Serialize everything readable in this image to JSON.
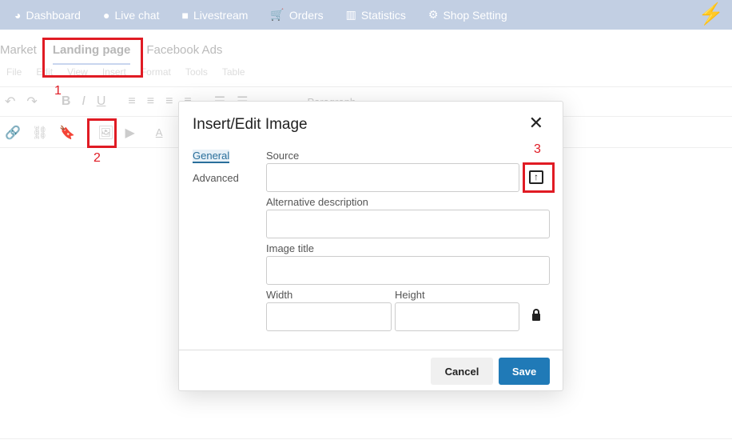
{
  "nav": [
    {
      "icon": "dashboard-icon",
      "glyph": "◕",
      "label": "Dashboard"
    },
    {
      "icon": "messenger-icon",
      "glyph": "●",
      "label": "Live chat"
    },
    {
      "icon": "video-icon",
      "glyph": "■",
      "label": "Livestream"
    },
    {
      "icon": "cart-icon",
      "glyph": "🛒",
      "label": "Orders"
    },
    {
      "icon": "bar-chart-icon",
      "glyph": "▥",
      "label": "Statistics"
    },
    {
      "icon": "gear-icon",
      "glyph": "⚙",
      "label": "Shop Setting"
    }
  ],
  "tabs": [
    "Market",
    "Landing page",
    "Facebook Ads"
  ],
  "menu": [
    "File",
    "Edit",
    "View",
    "Insert",
    "Format",
    "Tools",
    "Table"
  ],
  "toolbar": {
    "paragraph": "Paragraph"
  },
  "annotations": [
    "1",
    "2",
    "3"
  ],
  "dialog": {
    "title": "Insert/Edit Image",
    "close": "✕",
    "tabs": [
      "General",
      "Advanced"
    ],
    "source_label": "Source",
    "alt_label": "Alternative description",
    "title_label": "Image title",
    "width_label": "Width",
    "height_label": "Height",
    "cancel": "Cancel",
    "save": "Save"
  },
  "colors": {
    "nav": "#c2cfe3",
    "save": "#207ab7",
    "annotation": "#e01b24"
  }
}
